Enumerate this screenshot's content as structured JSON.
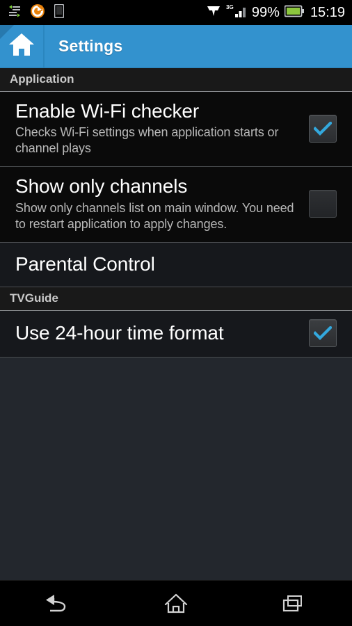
{
  "statusbar": {
    "left_icons": [
      {
        "name": "data-transfer-icon",
        "label": "data transfer"
      },
      {
        "name": "sync-app-icon",
        "label": "sync",
        "color": "#e8820c"
      },
      {
        "name": "device-icon",
        "label": "device"
      }
    ],
    "right_icons": [
      {
        "name": "vpn-icon",
        "label": "vpn"
      },
      {
        "name": "signal-3g-icon",
        "label": "3G"
      }
    ],
    "network_type": "3G",
    "battery_percent": "99%",
    "battery_color": "#8cc63e",
    "clock": "15:19"
  },
  "actionbar": {
    "title": "Settings",
    "home_icon": "home-icon",
    "up_affordance": "up-caret",
    "accent_color": "#3392ce"
  },
  "sections": [
    {
      "header": "Application",
      "items": [
        {
          "title": "Enable Wi-Fi checker",
          "summary": "Checks Wi-Fi settings when application starts or channel plays",
          "widget": "checkbox",
          "checked": true
        },
        {
          "title": "Show only channels",
          "summary": "Show only channels list on main window. You need to restart application to apply changes.",
          "widget": "checkbox",
          "checked": false
        },
        {
          "title": "Parental Control",
          "summary": "",
          "widget": "none",
          "checked": false
        }
      ]
    },
    {
      "header": "TVGuide",
      "items": [
        {
          "title": "Use 24-hour time format",
          "summary": "",
          "widget": "checkbox",
          "checked": true
        }
      ]
    }
  ],
  "navbar": {
    "buttons": [
      {
        "name": "nav-back-button",
        "label": "Back"
      },
      {
        "name": "nav-home-button",
        "label": "Home"
      },
      {
        "name": "nav-recents-button",
        "label": "Recent apps"
      }
    ]
  },
  "colors": {
    "checkbox_check": "#33a8dd",
    "accent": "#3392ce",
    "row_bg": "#0a0a0a",
    "page_bg": "#23272d"
  }
}
